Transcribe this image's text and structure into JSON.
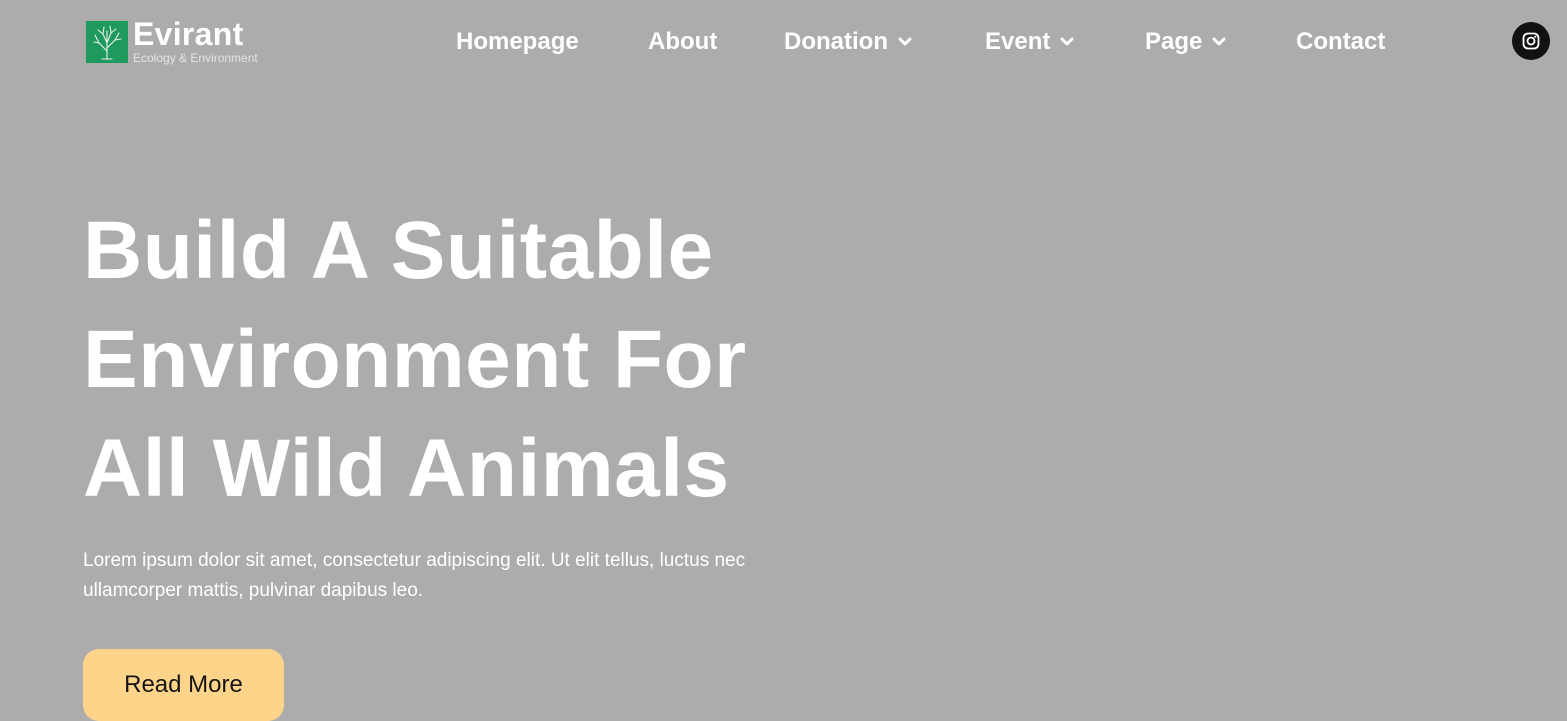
{
  "logo": {
    "name": "Evirant",
    "tagline": "Ecology & Environment",
    "mark_color": "#1f9a5e"
  },
  "nav": {
    "items": [
      {
        "label": "Homepage",
        "has_dropdown": false
      },
      {
        "label": "About",
        "has_dropdown": false
      },
      {
        "label": "Donation",
        "has_dropdown": true
      },
      {
        "label": "Event",
        "has_dropdown": true
      },
      {
        "label": "Page",
        "has_dropdown": true
      },
      {
        "label": "Contact",
        "has_dropdown": false
      }
    ]
  },
  "social": {
    "icon": "instagram-icon"
  },
  "hero": {
    "title_lines": [
      "Build A Suitable",
      "Environment For",
      "All Wild Animals"
    ],
    "text_lines": [
      "Lorem ipsum dolor sit amet, consectetur adipiscing elit. Ut elit tellus, luctus nec",
      "ullamcorper mattis, pulvinar dapibus leo."
    ],
    "button_label": "Read More"
  },
  "colors": {
    "background": "#acacac",
    "text": "#ffffff",
    "button": "#fed48a",
    "social_bg": "#111111"
  }
}
